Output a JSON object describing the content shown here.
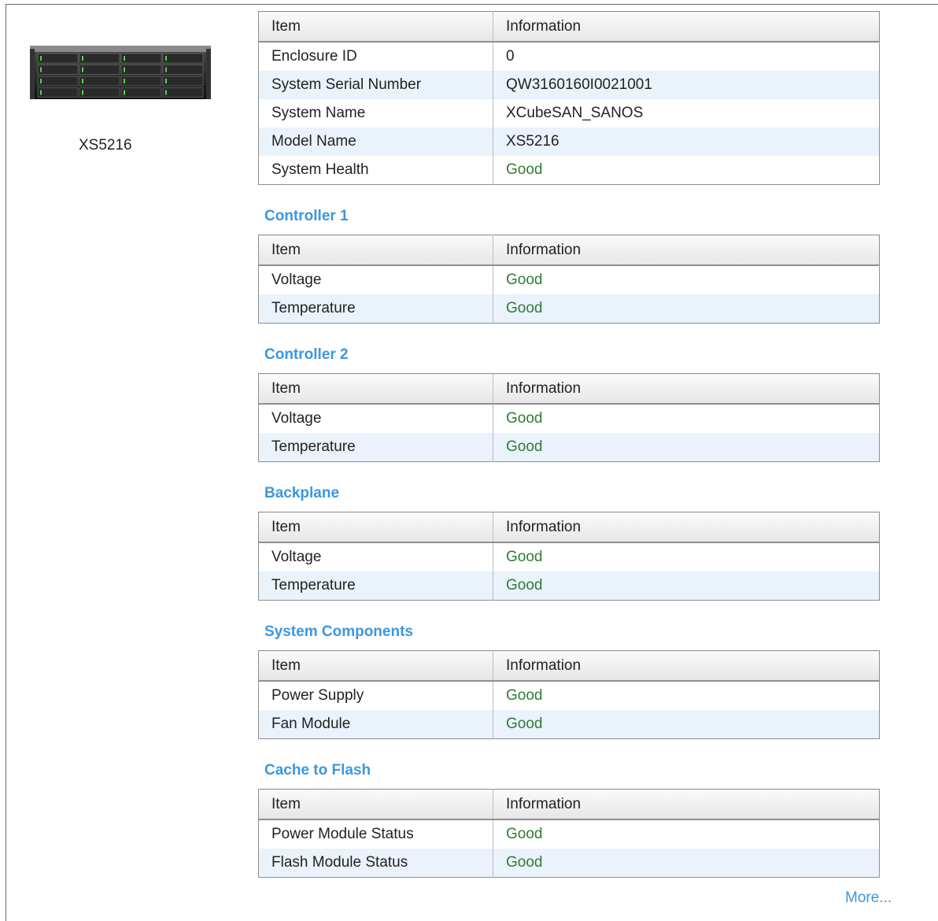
{
  "device": {
    "model_label": "XS5216"
  },
  "columns": {
    "item": "Item",
    "information": "Information"
  },
  "system_table": {
    "rows": [
      {
        "item": "Enclosure ID",
        "info": "0",
        "status": false
      },
      {
        "item": "System Serial Number",
        "info": "QW3160160I0021001",
        "status": false
      },
      {
        "item": "System Name",
        "info": "XCubeSAN_SANOS",
        "status": false
      },
      {
        "item": "Model Name",
        "info": "XS5216",
        "status": false
      },
      {
        "item": "System Health",
        "info": "Good",
        "status": true
      }
    ]
  },
  "sections": [
    {
      "title": "Controller 1",
      "rows": [
        {
          "item": "Voltage",
          "info": "Good"
        },
        {
          "item": "Temperature",
          "info": "Good"
        }
      ]
    },
    {
      "title": "Controller 2",
      "rows": [
        {
          "item": "Voltage",
          "info": "Good"
        },
        {
          "item": "Temperature",
          "info": "Good"
        }
      ]
    },
    {
      "title": "Backplane",
      "rows": [
        {
          "item": "Voltage",
          "info": "Good"
        },
        {
          "item": "Temperature",
          "info": "Good"
        }
      ]
    },
    {
      "title": "System Components",
      "rows": [
        {
          "item": "Power Supply",
          "info": "Good"
        },
        {
          "item": "Fan Module",
          "info": "Good"
        }
      ]
    },
    {
      "title": "Cache to Flash",
      "rows": [
        {
          "item": "Power Module Status",
          "info": "Good"
        },
        {
          "item": "Flash Module Status",
          "info": "Good"
        }
      ]
    }
  ],
  "more_link": "More...",
  "colors": {
    "accent": "#3b97e0",
    "status_good": "#2e7d32",
    "row_alt": "#eaf2fb"
  }
}
